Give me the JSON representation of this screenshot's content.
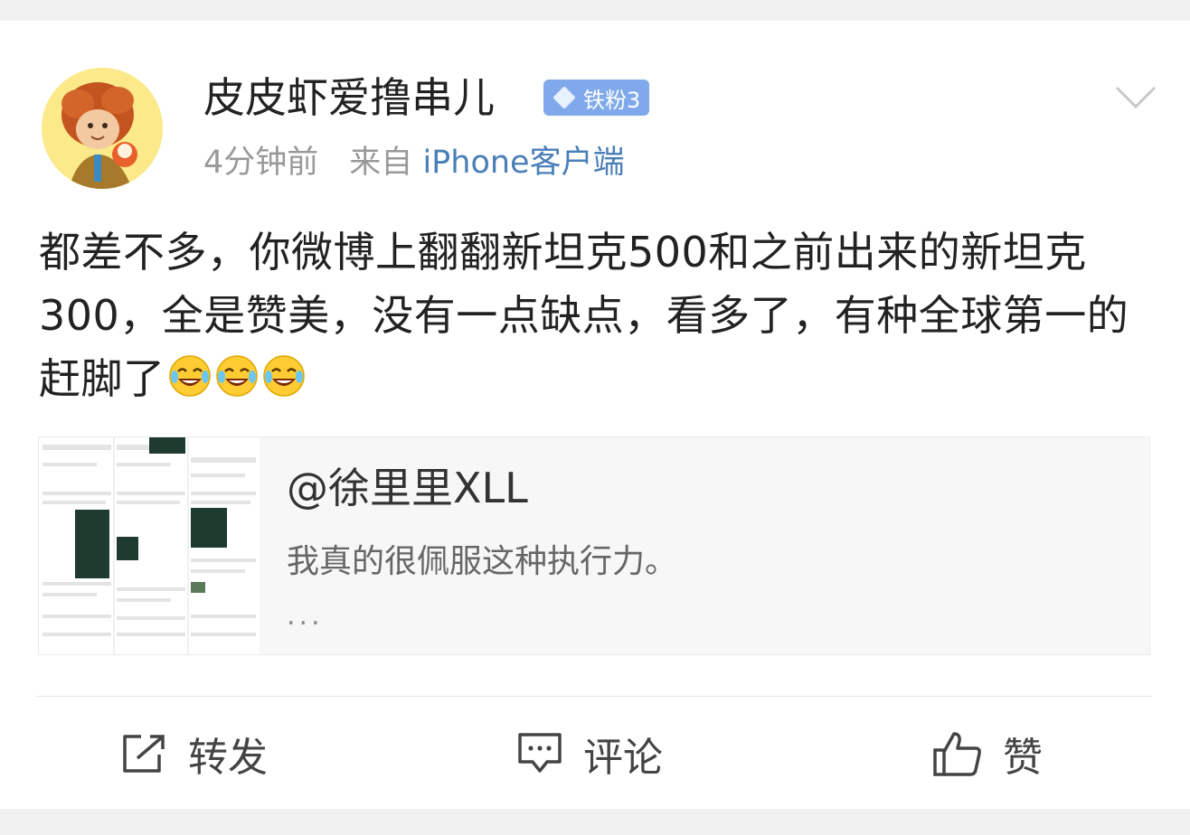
{
  "post": {
    "author": {
      "name": "皮皮虾爱撸串儿",
      "badge": "铁粉3",
      "avatar_icon": "monkey-king-avatar"
    },
    "time": "4分钟前",
    "source_prefix": "来自",
    "source": "iPhone客户端",
    "text": "都差不多，你微博上翻翻新坦克500和之前出来的新坦克300，全是赞美，没有一点缺点，看多了，有种全球第一的赶脚了",
    "emojis": [
      "laugh-cry-emoji",
      "laugh-cry-emoji",
      "laugh-cry-emoji"
    ]
  },
  "quoted": {
    "handle": "@徐里里XLL",
    "text": "我真的很佩服这种执行力。",
    "more": "..."
  },
  "actions": {
    "repost": "转发",
    "comment": "评论",
    "like": "赞"
  },
  "colors": {
    "badge_bg": "#7fa9ea",
    "source_link": "#4a7fb8",
    "background": "#ffffff"
  }
}
